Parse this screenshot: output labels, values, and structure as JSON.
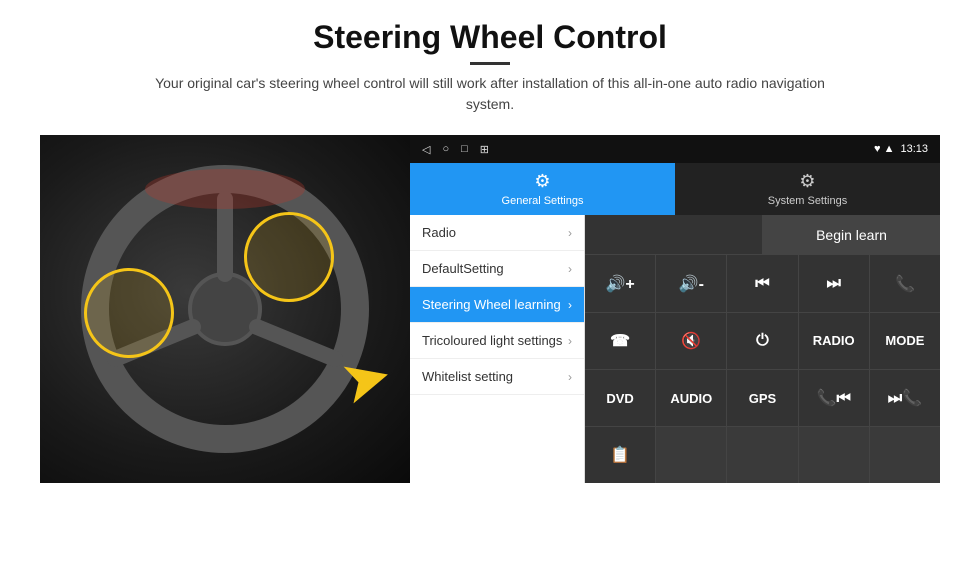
{
  "header": {
    "title": "Steering Wheel Control",
    "subtitle": "Your original car's steering wheel control will still work after installation of this all-in-one auto radio navigation system."
  },
  "status_bar": {
    "time": "13:13",
    "icons": [
      "◁",
      "○",
      "□",
      "⊞"
    ],
    "signal_icons": [
      "♥",
      "▲"
    ]
  },
  "tabs": [
    {
      "id": "general",
      "label": "General Settings",
      "icon": "⚙",
      "active": true
    },
    {
      "id": "system",
      "label": "System Settings",
      "icon": "⚙",
      "active": false
    }
  ],
  "menu_items": [
    {
      "label": "Radio",
      "active": false
    },
    {
      "label": "DefaultSetting",
      "active": false
    },
    {
      "label": "Steering Wheel learning",
      "active": true
    },
    {
      "label": "Tricoloured light settings",
      "active": false
    },
    {
      "label": "Whitelist setting",
      "active": false
    }
  ],
  "controls": {
    "begin_learn_label": "Begin learn",
    "rows": [
      [
        {
          "content": "🔊+",
          "type": "icon"
        },
        {
          "content": "🔊-",
          "type": "icon"
        },
        {
          "content": "⏮",
          "type": "icon"
        },
        {
          "content": "⏭",
          "type": "icon"
        },
        {
          "content": "📞",
          "type": "icon"
        }
      ],
      [
        {
          "content": "📞",
          "type": "icon"
        },
        {
          "content": "🔇",
          "type": "icon"
        },
        {
          "content": "⏻",
          "type": "icon"
        },
        {
          "content": "RADIO",
          "type": "text"
        },
        {
          "content": "MODE",
          "type": "text"
        }
      ],
      [
        {
          "content": "DVD",
          "type": "text"
        },
        {
          "content": "AUDIO",
          "type": "text"
        },
        {
          "content": "GPS",
          "type": "text"
        },
        {
          "content": "📞⏮",
          "type": "icon"
        },
        {
          "content": "⏭📞",
          "type": "icon"
        }
      ],
      [
        {
          "content": "📋",
          "type": "icon"
        },
        {
          "content": "",
          "type": "empty"
        },
        {
          "content": "",
          "type": "empty"
        },
        {
          "content": "",
          "type": "empty"
        },
        {
          "content": "",
          "type": "empty"
        }
      ]
    ]
  },
  "steering_wheel": {
    "arrow_symbol": "➤"
  }
}
